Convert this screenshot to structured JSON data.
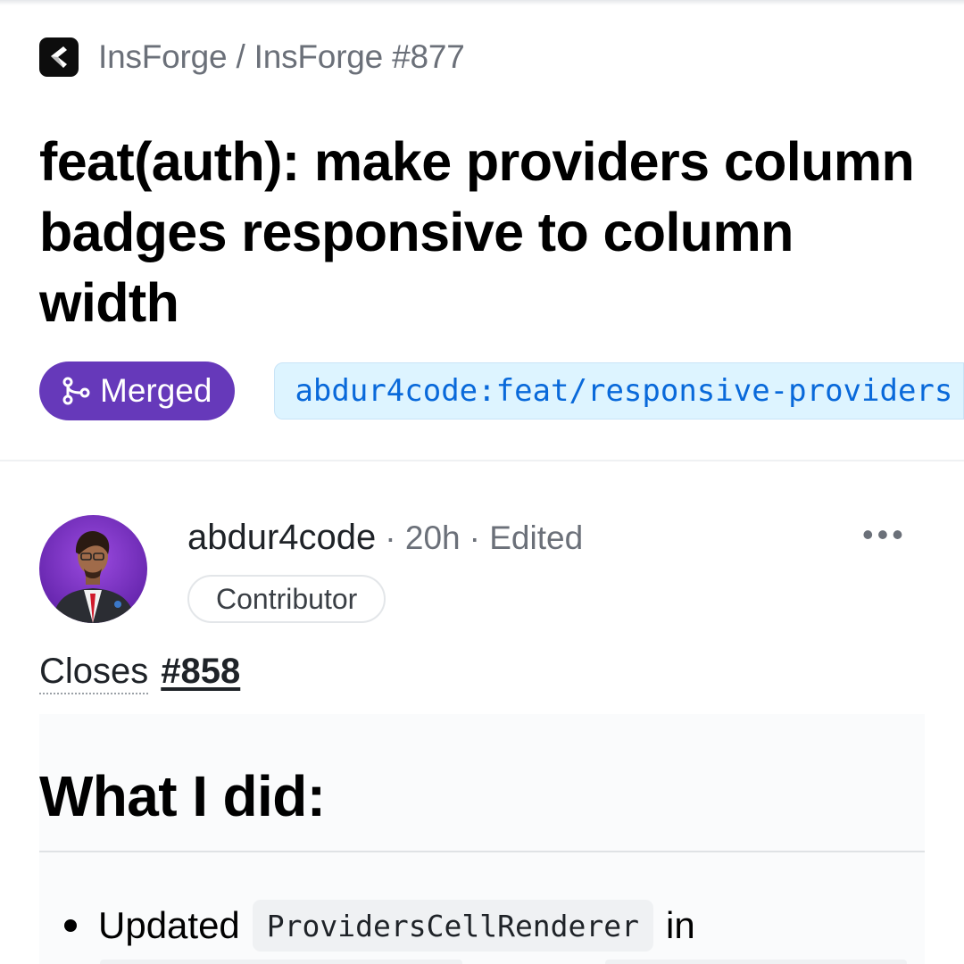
{
  "header": {
    "breadcrumb": "InsForge / InsForge #877",
    "logo_icon": "insforge-logo-icon"
  },
  "pr": {
    "title": "feat(auth): make providers column badges responsive to column width",
    "status": "Merged",
    "status_color": "#6639ba",
    "branch": "abdur4code:feat/responsive-providers"
  },
  "comment": {
    "author": "abdur4code",
    "time": "· 20h",
    "edited": "· Edited",
    "role": "Contributor",
    "more_label": "•••",
    "closes_label": "Closes",
    "issue_ref": "#858",
    "heading": "What I did:",
    "bullet": {
      "text_before": "Updated",
      "code": "ProvidersCellRenderer",
      "text_after": "in"
    }
  }
}
